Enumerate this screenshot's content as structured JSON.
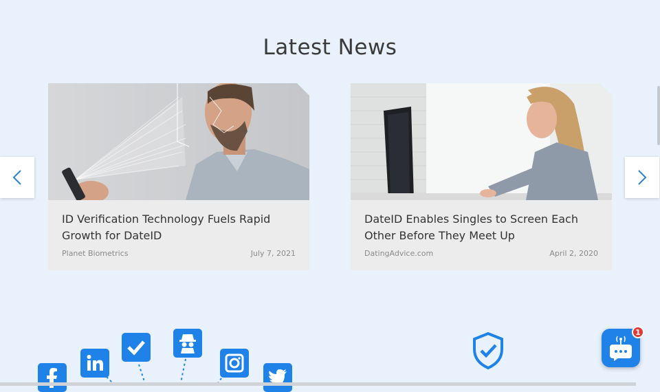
{
  "section": {
    "title": "Latest News"
  },
  "carousel": {
    "prev_icon": "chevron-left-icon",
    "next_icon": "chevron-right-icon",
    "cards": [
      {
        "title": "ID Verification Technology Fuels Rapid Growth for DateID",
        "source": "Planet Biometrics",
        "date": "July 7, 2021"
      },
      {
        "title": "DateID Enables Singles to Screen Each Other Before They Meet Up",
        "source": "DatingAdvice.com",
        "date": "April 2, 2020"
      }
    ]
  },
  "social_icons": [
    "facebook-icon",
    "linkedin-icon",
    "verified-check-icon",
    "spy-icon",
    "instagram-icon",
    "twitter-icon"
  ],
  "shield_icon": "shield-check-icon",
  "chat": {
    "badge_count": "1"
  },
  "colors": {
    "accent": "#1f82e8",
    "background": "#e8f1fc",
    "badge": "#e53935"
  }
}
